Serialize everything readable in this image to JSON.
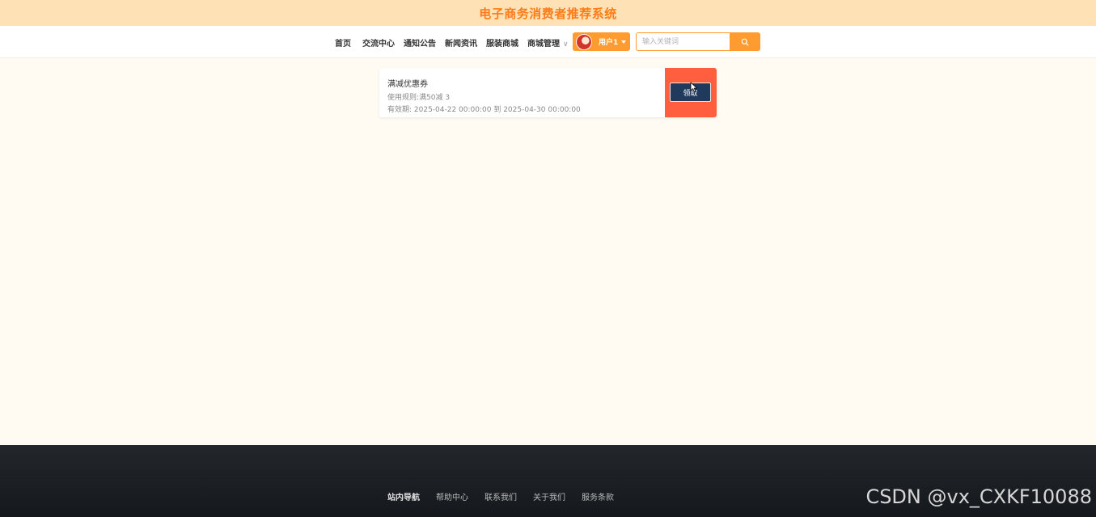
{
  "header": {
    "title": "电子商务消费者推荐系统"
  },
  "nav": {
    "items": [
      "首页",
      "交流中心",
      "通知公告",
      "新闻资讯",
      "服装商城",
      "商城管理"
    ]
  },
  "user": {
    "name": "用户1"
  },
  "search": {
    "placeholder": "输入关键词",
    "value": ""
  },
  "coupon": {
    "title": "满减优惠券",
    "rule": "使用规则:满50减 3",
    "validity": "有效期:  2025-04-22 00:00:00 到 2025-04-30 00:00:00",
    "claim_label": "领取"
  },
  "footer": {
    "links": [
      "站内导航",
      "帮助中心",
      "联系我们",
      "关于我们",
      "服务条款"
    ]
  },
  "watermark": "CSDN @vx_CXKF10088",
  "colors": {
    "accent": "#ff9b2f",
    "title": "#ff7b16",
    "coupon_side": "#ff5f3f",
    "claim_button": "#1f3a5c",
    "footer": "#1c2025"
  },
  "icons": {
    "search": "search-icon",
    "cursor": "mouse-pointer-icon",
    "dropdown": "chevron-down-icon"
  }
}
